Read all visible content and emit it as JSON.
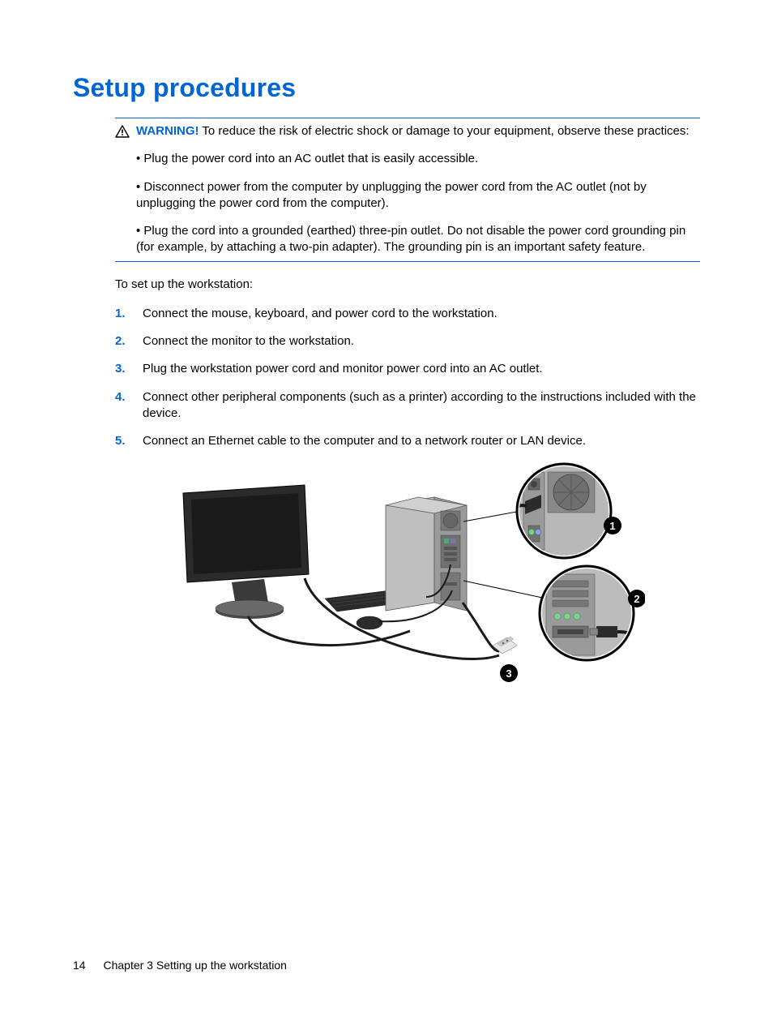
{
  "title": "Setup procedures",
  "warning": {
    "label": "WARNING!",
    "intro": "To reduce the risk of electric shock or damage to your equipment, observe these practices:",
    "bullets": [
      "• Plug the power cord into an AC outlet that is easily accessible.",
      "• Disconnect power from the computer by unplugging the power cord from the AC outlet (not by unplugging the power cord from the computer).",
      "• Plug the cord into a grounded (earthed) three-pin outlet. Do not disable the power cord grounding pin (for example, by attaching a two-pin adapter). The grounding pin is an important safety feature."
    ]
  },
  "lead": "To set up the workstation:",
  "steps": [
    "Connect the mouse, keyboard, and power cord to the workstation.",
    "Connect the monitor to the workstation.",
    "Plug the workstation power cord and monitor power cord into an AC outlet.",
    "Connect other peripheral components (such as a printer) according to the instructions included with the device.",
    "Connect an Ethernet cable to the computer and to a network router or LAN device."
  ],
  "figure": {
    "callouts": [
      "1",
      "2",
      "3"
    ]
  },
  "footer": {
    "page": "14",
    "chapter": "Chapter 3   Setting up the workstation"
  }
}
